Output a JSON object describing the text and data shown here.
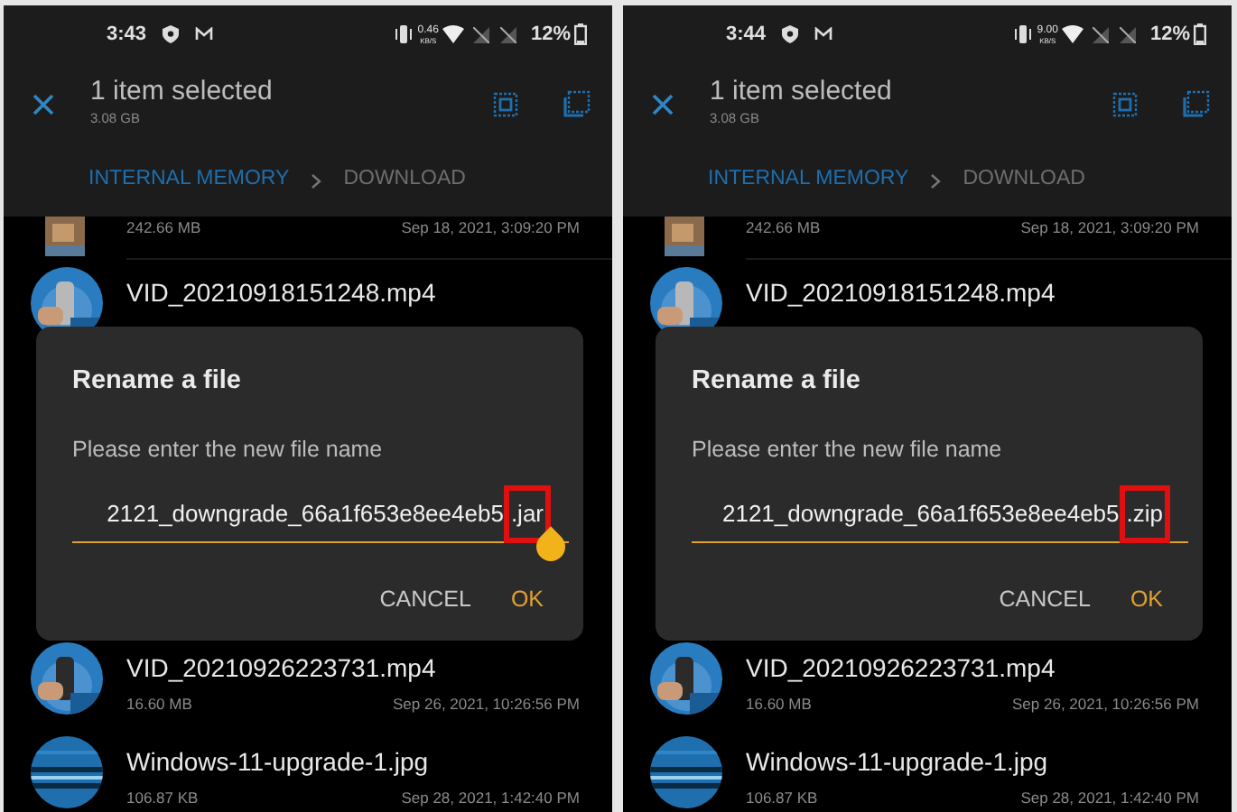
{
  "panels": [
    {
      "status_bar": {
        "time": "3:43",
        "net_speed": "0.46",
        "net_unit": "KB/S",
        "battery": "12%"
      },
      "header": {
        "title": "1 item selected",
        "subtitle": "3.08 GB"
      },
      "breadcrumb": [
        {
          "label": "INTERNAL MEMORY",
          "selected": true
        },
        {
          "label": "DOWNLOAD",
          "selected": false
        }
      ],
      "files_above": [
        {
          "size": "242.66 MB",
          "date": "Sep 18, 2021, 3:09:20 PM"
        },
        {
          "name": "VID_20210918151248.mp4"
        }
      ],
      "dialog": {
        "title": "Rename a file",
        "message": "Please enter the new file name",
        "value": "2121_downgrade_66a1f653e8ee4eb5",
        "highlighted": ".jar",
        "handle": true,
        "buttons": [
          {
            "label": "CANCEL",
            "kind": "secondary"
          },
          {
            "label": "OK",
            "kind": "primary"
          }
        ]
      },
      "files_below": [
        {
          "name": "VID_20210926223731.mp4",
          "size": "16.60 MB",
          "date": "Sep 26, 2021, 10:26:56 PM"
        },
        {
          "name": "Windows-11-upgrade-1.jpg",
          "size": "106.87 KB",
          "date": "Sep 28, 2021, 1:42:40 PM"
        }
      ]
    },
    {
      "status_bar": {
        "time": "3:44",
        "net_speed": "9.00",
        "net_unit": "KB/S",
        "battery": "12%"
      },
      "header": {
        "title": "1 item selected",
        "subtitle": "3.08 GB"
      },
      "breadcrumb": [
        {
          "label": "INTERNAL MEMORY",
          "selected": true
        },
        {
          "label": "DOWNLOAD",
          "selected": false
        }
      ],
      "files_above": [
        {
          "size": "242.66 MB",
          "date": "Sep 18, 2021, 3:09:20 PM"
        },
        {
          "name": "VID_20210918151248.mp4"
        }
      ],
      "dialog": {
        "title": "Rename a file",
        "message": "Please enter the new file name",
        "value": "2121_downgrade_66a1f653e8ee4eb5",
        "highlighted": ".zip",
        "handle": false,
        "buttons": [
          {
            "label": "CANCEL",
            "kind": "secondary"
          },
          {
            "label": "OK",
            "kind": "primary"
          }
        ]
      },
      "files_below": [
        {
          "name": "VID_20210926223731.mp4",
          "size": "16.60 MB",
          "date": "Sep 26, 2021, 10:26:56 PM"
        },
        {
          "name": "Windows-11-upgrade-1.jpg",
          "size": "106.87 KB",
          "date": "Sep 28, 2021, 1:42:40 PM"
        }
      ]
    }
  ]
}
